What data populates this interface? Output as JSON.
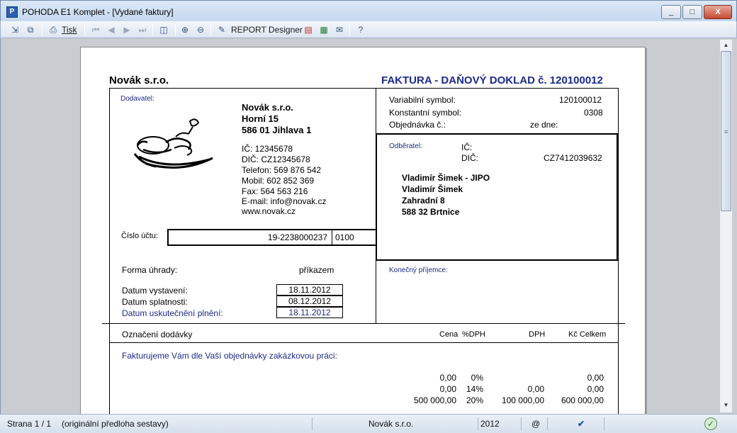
{
  "window": {
    "title": "POHODA E1 Komplet - [Vydané faktury]",
    "controls": {
      "minimize": "_",
      "maximize": "□",
      "close": "X"
    }
  },
  "toolbar": {
    "print_label": "Tisk",
    "report_designer_label": "REPORT Designer"
  },
  "invoice": {
    "company_header": "Novák  s.r.o.",
    "doc_title": "FAKTURA - DAŇOVÝ DOKLAD č. 120100012",
    "supplier_label": "Dodavatel:",
    "supplier": {
      "name": "Novák  s.r.o.",
      "street": "Horní 15",
      "city": "586 01 Jihlava 1",
      "ic": "IČ: 12345678",
      "dic": "DIČ: CZ12345678",
      "phone": "Telefon: 569 876 542",
      "mobile": "Mobil: 602 852 369",
      "fax": "Fax: 564 563 216",
      "email": "E-mail: info@novak.cz",
      "web": "www.novak.cz"
    },
    "variable_symbol_label": "Variabilní symbol:",
    "variable_symbol": "120100012",
    "constant_symbol_label": "Konstantní symbol:",
    "constant_symbol": "0308",
    "order_label": "Objednávka č.:",
    "order_date_label": "ze dne:",
    "customer_label": "Odběratel:",
    "customer_ic_label": "IČ:",
    "customer_dic_label": "DIČ:",
    "customer_dic": "CZ7412039632",
    "customer": {
      "line1": "Vladimír Šimek - JIPO",
      "line2": "Vladimír Šimek",
      "line3": "Zahradní 8",
      "line4": "588 32 Brtnice"
    },
    "account_label": "Číslo účtu:",
    "account_number": "19-2238000237",
    "bank_code": "0100",
    "payment_label": "Forma úhrady:",
    "payment_value": "příkazem",
    "final_recipient_label": "Konečný příjemce:",
    "issue_date_label": "Datum vystavení:",
    "issue_date": "18.11.2012",
    "due_date_label": "Datum splatnosti:",
    "due_date": "08.12.2012",
    "taxable_date_label": "Datum uskutečnění plnění:",
    "taxable_date": "18.11.2012",
    "items_header": {
      "delivery": "Označení dodávky",
      "price": "Cena",
      "vat_pct": "%DPH",
      "vat": "DPH",
      "total": "Kč Celkem"
    },
    "invoice_text": "Fakturujeme Vám dle Vaší objednávky zakázkovou práci:",
    "vat_rows": [
      {
        "price": "0,00",
        "pct": "0%",
        "vat": "",
        "total": "0,00"
      },
      {
        "price": "0,00",
        "pct": "14%",
        "vat": "0,00",
        "total": "0,00"
      },
      {
        "price": "500 000,00",
        "pct": "20%",
        "vat": "100 000,00",
        "total": "600 000,00"
      }
    ]
  },
  "statusbar": {
    "page": "Strana 1 / 1",
    "template": "(originální předloha sestavy)",
    "company": "Novák  s.r.o.",
    "year": "2012",
    "at": "@"
  }
}
